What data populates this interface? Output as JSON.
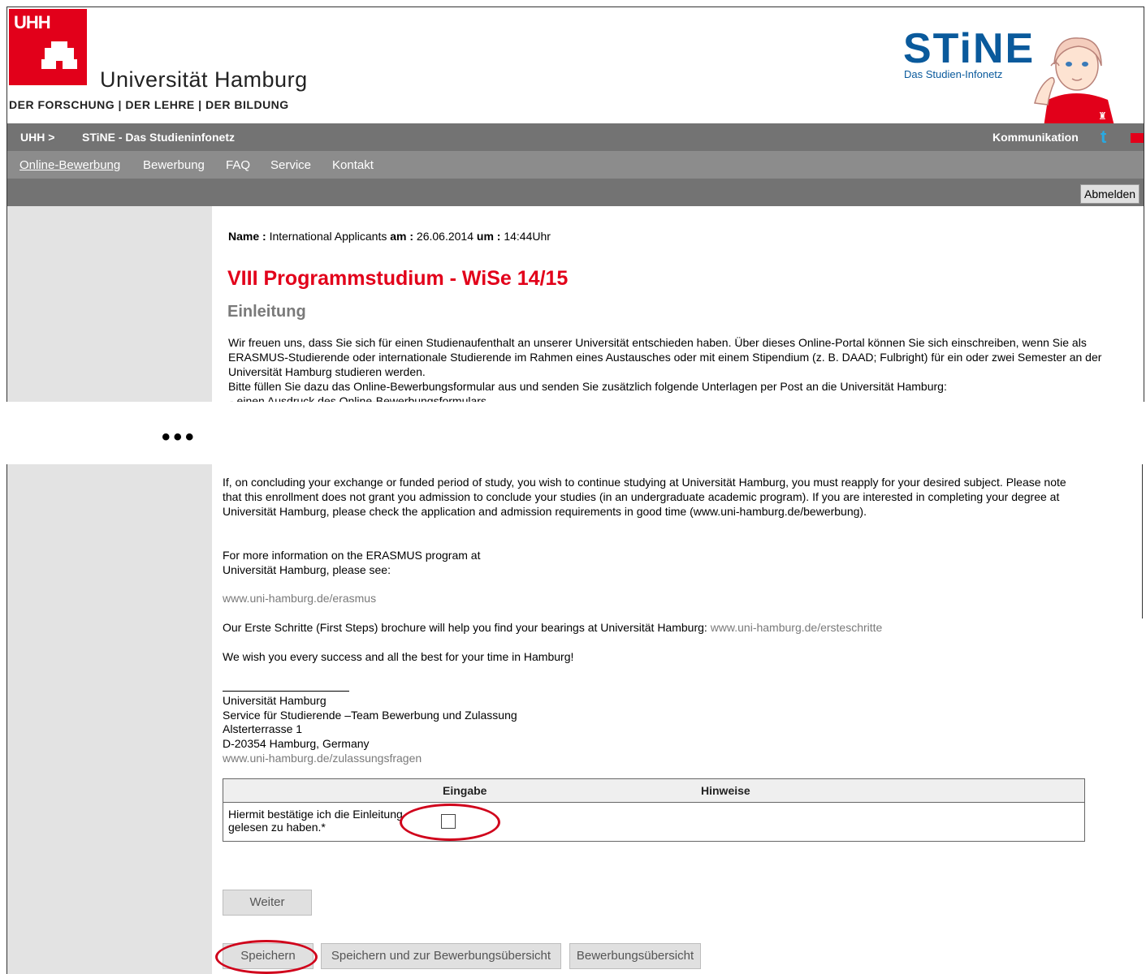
{
  "header": {
    "logo_text": "UHH",
    "university_name": "Universität Hamburg",
    "tagline": "DER FORSCHUNG | DER LEHRE | DER BILDUNG",
    "stine_logo": "STiNE",
    "stine_subtitle": "Das Studien-Infonetz"
  },
  "topbar": {
    "crumb_uhh": "UHH >",
    "crumb_stine": "STiNE - Das Studieninfonetz",
    "kommunikation": "Kommunikation"
  },
  "nav": {
    "items": [
      "Online-Bewerbung",
      "Bewerbung",
      "FAQ",
      "Service",
      "Kontakt"
    ]
  },
  "logout_label": "Abmelden",
  "applicant": {
    "name_label": "Name :",
    "name_value": "International Applicants",
    "date_label": "am :",
    "date_value": "26.06.2014",
    "time_label": "um :",
    "time_value": "14:44Uhr"
  },
  "program_title": "VIII Programmstudium - WiSe 14/15",
  "intro_heading": "Einleitung",
  "intro_text_1": "Wir freuen uns, dass Sie sich für einen Studienaufenthalt an unserer Universität entschieden haben. Über dieses Online-Portal können Sie sich einschreiben, wenn Sie als ERASMUS-Studierende oder internationale Studierende im Rahmen eines Austausches oder mit einem Stipendium (z. B. DAAD; Fulbright) für ein oder zwei Semester an der Universität Hamburg studieren werden.",
  "intro_text_2": "Bitte füllen Sie dazu das Online-Bewerbungsformular aus und senden Sie zusätzlich folgende Unterlagen per Post an die Universität Hamburg:",
  "intro_text_3": "- einen Ausdruck des Online-Bewerbungsformulars",
  "ellipsis": "•••",
  "english": {
    "reapply": "If, on concluding your exchange or funded period of study, you wish to continue studying at Universität Hamburg, you must reapply for your desired subject. Please note that this enrollment does not grant you admission to conclude your studies (in an undergraduate academic program). If you are interested in completing your degree at Universität Hamburg, please check the application and admission requirements in good time (www.uni-hamburg.de/bewerbung).",
    "more_info_1": "For more information on the ERASMUS program at",
    "more_info_2": "Universität Hamburg, please see:",
    "erasmus_link": "www.uni-hamburg.de/erasmus",
    "first_steps": "Our Erste Schritte (First Steps) brochure will help you find your bearings at Universität Hamburg:",
    "first_steps_link": "www.uni-hamburg.de/ersteschritte",
    "wish": "We wish you every success and all the best for your time in Hamburg!"
  },
  "signature": {
    "line1": "Universität Hamburg",
    "line2": "Service für Studierende –Team Bewerbung und Zulassung",
    "line3": "Alsterterrasse 1",
    "line4": "D-20354 Hamburg, Germany",
    "link": "www.uni-hamburg.de/zulassungsfragen"
  },
  "table": {
    "col_input": "Eingabe",
    "col_notes": "Hinweise",
    "confirm_label": "Hiermit bestätige ich die Einleitung gelesen zu haben.*"
  },
  "buttons": {
    "next": "Weiter",
    "save": "Speichern",
    "save_overview": "Speichern und zur Bewerbungsübersicht",
    "overview": "Bewerbungsübersicht"
  },
  "colors": {
    "brand_red": "#e2001a",
    "stine_blue": "#0a5a9c",
    "annotation_red": "#d0021b"
  }
}
